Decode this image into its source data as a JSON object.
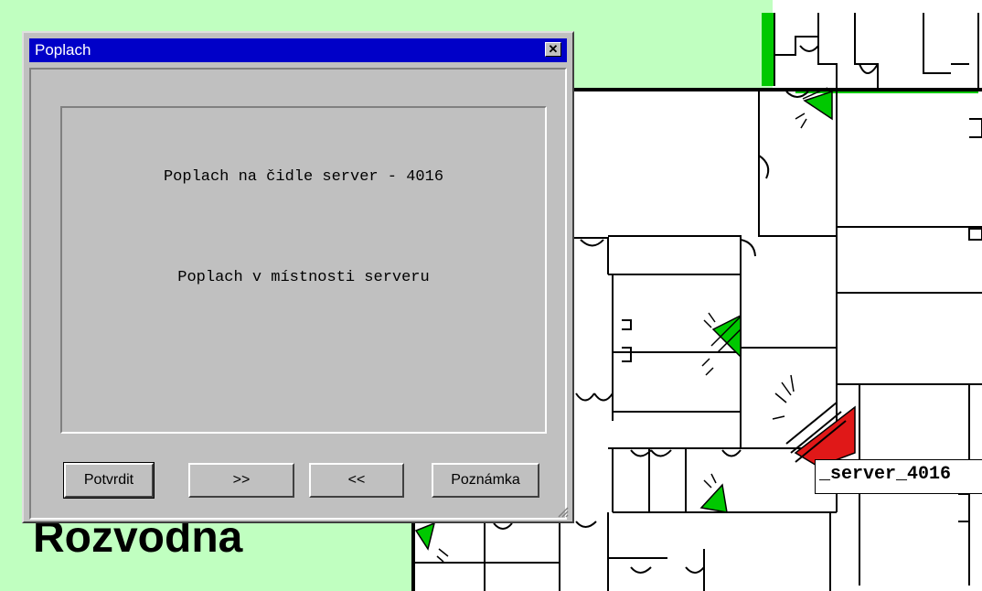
{
  "dialog": {
    "title": "Poplach",
    "close_icon": "close-icon",
    "message_line1": "Poplach na čidle server - 4016",
    "message_line2": "Poplach v místnosti serveru",
    "buttons": {
      "confirm": "Potvrdit",
      "next": ">>",
      "prev": "<<",
      "note": "Poznámka"
    }
  },
  "map": {
    "sensor_label": "_server_4016",
    "background_text": "Rozvodna",
    "colors": {
      "outside_area": "#c0ffc0",
      "sensor_ok": "#00c800",
      "sensor_alarm": "#e01818",
      "walls": "#000000"
    }
  }
}
